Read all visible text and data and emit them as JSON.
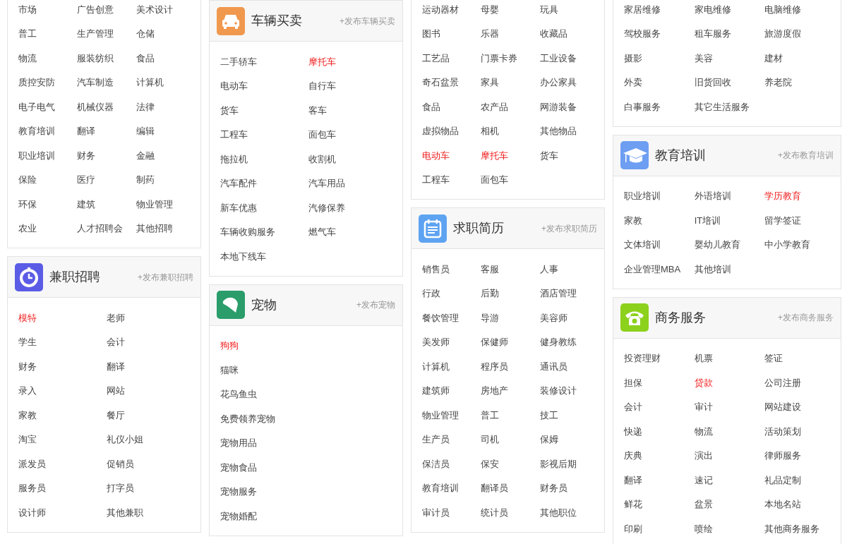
{
  "columns": [
    {
      "panels": [
        {
          "rows": [
            [
              {
                "text": "市场",
                "highlighted": false
              },
              {
                "text": "广告创意",
                "highlighted": false
              },
              {
                "text": "美术设计",
                "highlighted": false
              }
            ],
            [
              {
                "text": "普工",
                "highlighted": false
              },
              {
                "text": "生产管理",
                "highlighted": false
              },
              {
                "text": "仓储",
                "highlighted": false
              }
            ],
            [
              {
                "text": "物流",
                "highlighted": false
              },
              {
                "text": "服装纺织",
                "highlighted": false
              },
              {
                "text": "食品",
                "highlighted": false
              }
            ],
            [
              {
                "text": "质控安防",
                "highlighted": false
              },
              {
                "text": "汽车制造",
                "highlighted": false
              },
              {
                "text": "计算机",
                "highlighted": false
              }
            ],
            [
              {
                "text": "电子电气",
                "highlighted": false
              },
              {
                "text": "机械仪器",
                "highlighted": false
              },
              {
                "text": "法律",
                "highlighted": false
              }
            ],
            [
              {
                "text": "教育培训",
                "highlighted": false
              },
              {
                "text": "翻译",
                "highlighted": false
              },
              {
                "text": "编辑",
                "highlighted": false
              }
            ],
            [
              {
                "text": "职业培训",
                "highlighted": false
              },
              {
                "text": "财务",
                "highlighted": false
              },
              {
                "text": "金融",
                "highlighted": false
              }
            ],
            [
              {
                "text": "保险",
                "highlighted": false
              },
              {
                "text": "医疗",
                "highlighted": false
              },
              {
                "text": "制药",
                "highlighted": false
              }
            ],
            [
              {
                "text": "环保",
                "highlighted": false
              },
              {
                "text": "建筑",
                "highlighted": false
              },
              {
                "text": "物业管理",
                "highlighted": false
              }
            ],
            [
              {
                "text": "农业",
                "highlighted": false
              },
              {
                "text": "人才招聘会",
                "highlighted": false
              },
              {
                "text": "其他招聘",
                "highlighted": false
              }
            ]
          ]
        },
        {
          "title": "兼职招聘",
          "post_link": "+发布兼职招聘",
          "kind": "clock",
          "color": "#5b5ce6",
          "rows": [
            [
              {
                "text": "模特",
                "highlighted": true
              },
              {
                "text": "老师",
                "highlighted": false
              }
            ],
            [
              {
                "text": "学生",
                "highlighted": false
              },
              {
                "text": "会计",
                "highlighted": false
              }
            ],
            [
              {
                "text": "财务",
                "highlighted": false
              },
              {
                "text": "翻译",
                "highlighted": false
              }
            ],
            [
              {
                "text": "录入",
                "highlighted": false
              },
              {
                "text": "网站",
                "highlighted": false
              }
            ],
            [
              {
                "text": "家教",
                "highlighted": false
              },
              {
                "text": "餐厅",
                "highlighted": false
              }
            ],
            [
              {
                "text": "淘宝",
                "highlighted": false
              },
              {
                "text": "礼仪小姐",
                "highlighted": false
              }
            ],
            [
              {
                "text": "派发员",
                "highlighted": false
              },
              {
                "text": "促销员",
                "highlighted": false
              }
            ],
            [
              {
                "text": "服务员",
                "highlighted": false
              },
              {
                "text": "打字员",
                "highlighted": false
              }
            ],
            [
              {
                "text": "设计师",
                "highlighted": false
              },
              {
                "text": "其他兼职",
                "highlighted": false
              }
            ]
          ]
        }
      ]
    },
    {
      "panels": [
        {
          "title": "车辆买卖",
          "post_link": "+发布车辆买卖",
          "kind": "car",
          "color": "#f0984e",
          "rows": [
            [
              {
                "text": "二手轿车",
                "highlighted": false
              },
              {
                "text": "摩托车",
                "highlighted": true
              }
            ],
            [
              {
                "text": "电动车",
                "highlighted": false
              },
              {
                "text": "自行车",
                "highlighted": false
              }
            ],
            [
              {
                "text": "货车",
                "highlighted": false
              },
              {
                "text": "客车",
                "highlighted": false
              }
            ],
            [
              {
                "text": "工程车",
                "highlighted": false
              },
              {
                "text": "面包车",
                "highlighted": false
              }
            ],
            [
              {
                "text": "拖拉机",
                "highlighted": false
              },
              {
                "text": "收割机",
                "highlighted": false
              }
            ],
            [
              {
                "text": "汽车配件",
                "highlighted": false
              },
              {
                "text": "汽车用品",
                "highlighted": false
              }
            ],
            [
              {
                "text": "新车优惠",
                "highlighted": false
              },
              {
                "text": "汽修保养",
                "highlighted": false
              }
            ],
            [
              {
                "text": "车辆收购服务",
                "highlighted": false
              },
              {
                "text": "燃气车",
                "highlighted": false
              }
            ],
            [
              {
                "text": "本地下线车",
                "highlighted": false
              }
            ]
          ]
        },
        {
          "title": "宠物",
          "post_link": "+发布宠物",
          "kind": "dog",
          "color": "#2a9d6a",
          "rows": [
            [
              {
                "text": "狗狗",
                "highlighted": true
              }
            ],
            [
              {
                "text": "猫咪",
                "highlighted": false
              }
            ],
            [
              {
                "text": "花鸟鱼虫",
                "highlighted": false
              }
            ],
            [
              {
                "text": "免费领养宠物",
                "highlighted": false
              }
            ],
            [
              {
                "text": "宠物用品",
                "highlighted": false
              }
            ],
            [
              {
                "text": "宠物食品",
                "highlighted": false
              }
            ],
            [
              {
                "text": "宠物服务",
                "highlighted": false
              }
            ],
            [
              {
                "text": "宠物婚配",
                "highlighted": false
              }
            ]
          ]
        }
      ]
    },
    {
      "panels": [
        {
          "rows": [
            [
              {
                "text": "运动器材",
                "highlighted": false
              },
              {
                "text": "母婴",
                "highlighted": false
              },
              {
                "text": "玩具",
                "highlighted": false
              }
            ],
            [
              {
                "text": "图书",
                "highlighted": false
              },
              {
                "text": "乐器",
                "highlighted": false
              },
              {
                "text": "收藏品",
                "highlighted": false
              }
            ],
            [
              {
                "text": "工艺品",
                "highlighted": false
              },
              {
                "text": "门票卡券",
                "highlighted": false
              },
              {
                "text": "工业设备",
                "highlighted": false
              }
            ],
            [
              {
                "text": "奇石盆景",
                "highlighted": false
              },
              {
                "text": "家具",
                "highlighted": false
              },
              {
                "text": "办公家具",
                "highlighted": false
              }
            ],
            [
              {
                "text": "食品",
                "highlighted": false
              },
              {
                "text": "农产品",
                "highlighted": false
              },
              {
                "text": "网游装备",
                "highlighted": false
              }
            ],
            [
              {
                "text": "虚拟物品",
                "highlighted": false
              },
              {
                "text": "相机",
                "highlighted": false
              },
              {
                "text": "其他物品",
                "highlighted": false
              }
            ],
            [
              {
                "text": "电动车",
                "highlighted": true
              },
              {
                "text": "摩托车",
                "highlighted": true
              },
              {
                "text": "货车",
                "highlighted": false
              }
            ],
            [
              {
                "text": "工程车",
                "highlighted": false
              },
              {
                "text": "面包车",
                "highlighted": false
              }
            ]
          ]
        },
        {
          "title": "求职简历",
          "post_link": "+发布求职简历",
          "kind": "calendar",
          "color": "#5ea3f2",
          "rows": [
            [
              {
                "text": "销售员",
                "highlighted": false
              },
              {
                "text": "客服",
                "highlighted": false
              },
              {
                "text": "人事",
                "highlighted": false
              }
            ],
            [
              {
                "text": "行政",
                "highlighted": false
              },
              {
                "text": "后勤",
                "highlighted": false
              },
              {
                "text": "酒店管理",
                "highlighted": false
              }
            ],
            [
              {
                "text": "餐饮管理",
                "highlighted": false
              },
              {
                "text": "导游",
                "highlighted": false
              },
              {
                "text": "美容师",
                "highlighted": false
              }
            ],
            [
              {
                "text": "美发师",
                "highlighted": false
              },
              {
                "text": "保健师",
                "highlighted": false
              },
              {
                "text": "健身教练",
                "highlighted": false
              }
            ],
            [
              {
                "text": "计算机",
                "highlighted": false
              },
              {
                "text": "程序员",
                "highlighted": false
              },
              {
                "text": "通讯员",
                "highlighted": false
              }
            ],
            [
              {
                "text": "建筑师",
                "highlighted": false
              },
              {
                "text": "房地产",
                "highlighted": false
              },
              {
                "text": "装修设计",
                "highlighted": false
              }
            ],
            [
              {
                "text": "物业管理",
                "highlighted": false
              },
              {
                "text": "普工",
                "highlighted": false
              },
              {
                "text": "技工",
                "highlighted": false
              }
            ],
            [
              {
                "text": "生产员",
                "highlighted": false
              },
              {
                "text": "司机",
                "highlighted": false
              },
              {
                "text": "保姆",
                "highlighted": false
              }
            ],
            [
              {
                "text": "保洁员",
                "highlighted": false
              },
              {
                "text": "保安",
                "highlighted": false
              },
              {
                "text": "影视后期",
                "highlighted": false
              }
            ],
            [
              {
                "text": "教育培训",
                "highlighted": false
              },
              {
                "text": "翻译员",
                "highlighted": false
              },
              {
                "text": "财务员",
                "highlighted": false
              }
            ],
            [
              {
                "text": "审计员",
                "highlighted": false
              },
              {
                "text": "统计员",
                "highlighted": false
              },
              {
                "text": "其他职位",
                "highlighted": false
              }
            ]
          ]
        }
      ]
    },
    {
      "panels": [
        {
          "rows": [
            [
              {
                "text": "家居维修",
                "highlighted": false
              },
              {
                "text": "家电维修",
                "highlighted": false
              },
              {
                "text": "电脑维修",
                "highlighted": false
              }
            ],
            [
              {
                "text": "驾校服务",
                "highlighted": false
              },
              {
                "text": "租车服务",
                "highlighted": false
              },
              {
                "text": "旅游度假",
                "highlighted": false
              }
            ],
            [
              {
                "text": "摄影",
                "highlighted": false
              },
              {
                "text": "美容",
                "highlighted": false
              },
              {
                "text": "建材",
                "highlighted": false
              }
            ],
            [
              {
                "text": "外卖",
                "highlighted": false
              },
              {
                "text": "旧货回收",
                "highlighted": false
              },
              {
                "text": "养老院",
                "highlighted": false
              }
            ],
            [
              {
                "text": "白事服务",
                "highlighted": false
              },
              {
                "text": "其它生活服务",
                "highlighted": false
              }
            ]
          ]
        },
        {
          "title": "教育培训",
          "post_link": "+发布教育培训",
          "kind": "cap",
          "color": "#6d9ef2",
          "rows": [
            [
              {
                "text": "职业培训",
                "highlighted": false
              },
              {
                "text": "外语培训",
                "highlighted": false
              },
              {
                "text": "学历教育",
                "highlighted": true
              }
            ],
            [
              {
                "text": "家教",
                "highlighted": false
              },
              {
                "text": "IT培训",
                "highlighted": false
              },
              {
                "text": "留学签证",
                "highlighted": false
              }
            ],
            [
              {
                "text": "文体培训",
                "highlighted": false
              },
              {
                "text": "婴幼儿教育",
                "highlighted": false
              },
              {
                "text": "中小学教育",
                "highlighted": false
              }
            ],
            [
              {
                "text": "企业管理MBA",
                "highlighted": false
              },
              {
                "text": "其他培训",
                "highlighted": false
              }
            ]
          ]
        },
        {
          "title": "商务服务",
          "post_link": "+发布商务服务",
          "kind": "phone",
          "color": "#8cd11c",
          "rows": [
            [
              {
                "text": "投资理财",
                "highlighted": false
              },
              {
                "text": "机票",
                "highlighted": false
              },
              {
                "text": "签证",
                "highlighted": false
              }
            ],
            [
              {
                "text": "担保",
                "highlighted": false
              },
              {
                "text": "贷款",
                "highlighted": true
              },
              {
                "text": "公司注册",
                "highlighted": false
              }
            ],
            [
              {
                "text": "会计",
                "highlighted": false
              },
              {
                "text": "审计",
                "highlighted": false
              },
              {
                "text": "网站建设",
                "highlighted": false
              }
            ],
            [
              {
                "text": "快递",
                "highlighted": false
              },
              {
                "text": "物流",
                "highlighted": false
              },
              {
                "text": "活动策划",
                "highlighted": false
              }
            ],
            [
              {
                "text": "庆典",
                "highlighted": false
              },
              {
                "text": "演出",
                "highlighted": false
              },
              {
                "text": "律师服务",
                "highlighted": false
              }
            ],
            [
              {
                "text": "翻译",
                "highlighted": false
              },
              {
                "text": "速记",
                "highlighted": false
              },
              {
                "text": "礼品定制",
                "highlighted": false
              }
            ],
            [
              {
                "text": "鲜花",
                "highlighted": false
              },
              {
                "text": "盆景",
                "highlighted": false
              },
              {
                "text": "本地名站",
                "highlighted": false
              }
            ],
            [
              {
                "text": "印刷",
                "highlighted": false
              },
              {
                "text": "喷绘",
                "highlighted": false
              },
              {
                "text": "其他商务服务",
                "highlighted": false
              }
            ]
          ]
        }
      ]
    }
  ]
}
